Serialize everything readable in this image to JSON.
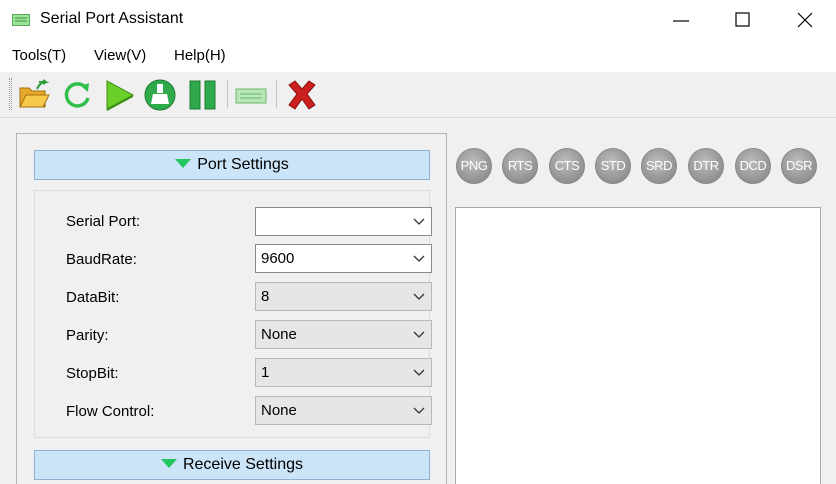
{
  "window": {
    "title": "Serial Port Assistant",
    "controls": [
      "minimize",
      "maximize",
      "close"
    ]
  },
  "menu": [
    {
      "label": "Tools(T)"
    },
    {
      "label": "View(V)"
    },
    {
      "label": "Help(H)"
    }
  ],
  "toolbar": {
    "buttons": [
      {
        "icon": "open-folder-icon"
      },
      {
        "icon": "refresh-icon"
      },
      {
        "icon": "play-icon"
      },
      {
        "icon": "clean-icon"
      },
      {
        "icon": "pause-icon"
      },
      {
        "icon": "serial-port-icon"
      },
      {
        "icon": "close-x-icon"
      }
    ]
  },
  "port_settings": {
    "header": "Port Settings",
    "fields": [
      {
        "label": "Serial Port:",
        "value": ""
      },
      {
        "label": "BaudRate:",
        "value": "9600"
      },
      {
        "label": "DataBit:",
        "value": "8"
      },
      {
        "label": "Parity:",
        "value": "None"
      },
      {
        "label": "StopBit:",
        "value": "1"
      },
      {
        "label": "Flow Control:",
        "value": "None"
      }
    ]
  },
  "receive_settings": {
    "header": "Receive Settings"
  },
  "signals": [
    "PNG",
    "RTS",
    "CTS",
    "STD",
    "SRD",
    "DTR",
    "DCD",
    "DSR"
  ],
  "colors": {
    "section_header_bg": "#cce4f7",
    "arrow_green": "#22c55e",
    "close_red": "#cc1f1f",
    "led_gray": "#9a9a9a"
  }
}
